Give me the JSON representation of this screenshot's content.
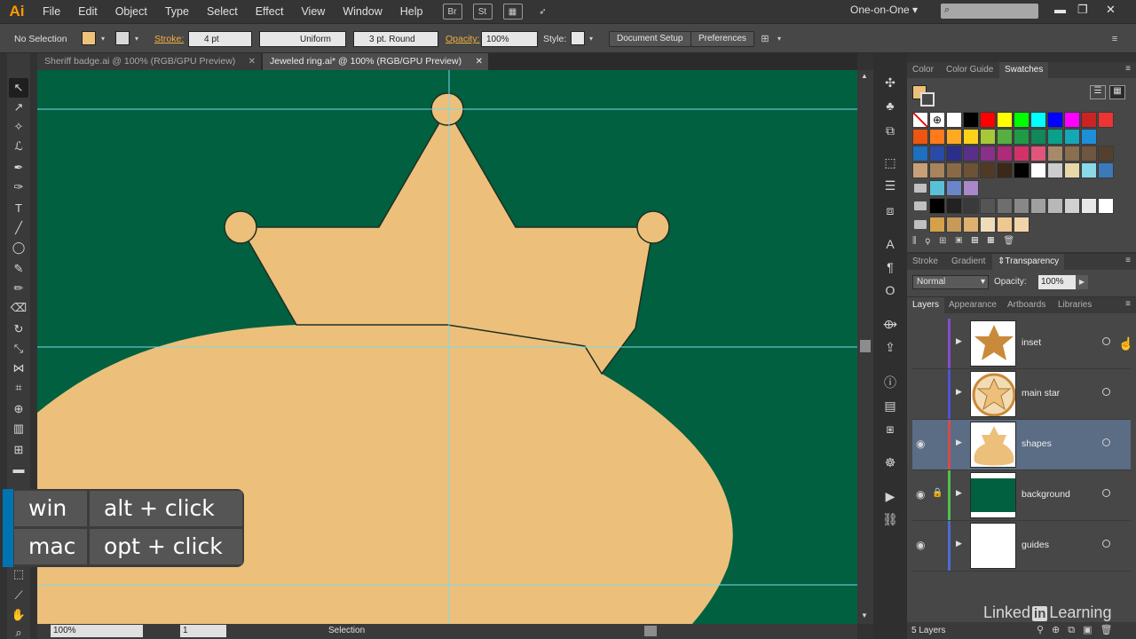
{
  "app": {
    "logo": "Ai"
  },
  "menu": [
    "File",
    "Edit",
    "Object",
    "Type",
    "Select",
    "Effect",
    "View",
    "Window",
    "Help"
  ],
  "menu_icons": {
    "bridge": "Br",
    "stock": "St"
  },
  "workspace": "One-on-One",
  "search_icon": "⌕",
  "control_bar": {
    "selection": "No Selection",
    "fill_color": "#eec27b",
    "stroke_label": "Stroke:",
    "stroke_weight": "4 pt",
    "stroke_profile": "Uniform",
    "brush": "3 pt. Round",
    "opacity_label": "Opacity:",
    "opacity_value": "100%",
    "style_label": "Style:",
    "document_setup": "Document Setup",
    "preferences": "Preferences"
  },
  "tabs": [
    {
      "label": "Sheriff badge.ai @ 100% (RGB/GPU Preview)",
      "active": false
    },
    {
      "label": "Jeweled ring.ai* @ 100% (RGB/GPU Preview)",
      "active": true
    }
  ],
  "status": {
    "zoom": "100%",
    "page": "1",
    "tool": "Selection"
  },
  "shortcut": {
    "win_key": "win",
    "win_action": "alt + click",
    "mac_key": "mac",
    "mac_action": "opt + click"
  },
  "colors": {
    "canvas_bg": "#006040",
    "shape_fill": "#ecc07a",
    "guide": "#7fd9e6",
    "selection_row": "#5b6c85"
  },
  "swatches_panel": {
    "tabs": [
      "Color",
      "Color Guide",
      "Swatches"
    ],
    "active_tab": "Swatches"
  },
  "transparency_panel": {
    "tabs": [
      "Stroke",
      "Gradient",
      "Transparency"
    ],
    "active_tab": "Transparency",
    "blend_mode": "Normal",
    "opacity_label": "Opacity:",
    "opacity_value": "100%"
  },
  "layers_panel": {
    "tabs": [
      "Layers",
      "Appearance",
      "Artboards",
      "Libraries"
    ],
    "active_tab": "Layers",
    "layers": [
      {
        "name": "inset",
        "color": "#8a4bd0",
        "visible": false,
        "locked": false,
        "selected": false
      },
      {
        "name": "main star",
        "color": "#4f53d6",
        "visible": false,
        "locked": false,
        "selected": false
      },
      {
        "name": "shapes",
        "color": "#d04e4e",
        "visible": true,
        "locked": false,
        "selected": true
      },
      {
        "name": "background",
        "color": "#4ec24e",
        "visible": true,
        "locked": true,
        "selected": false
      },
      {
        "name": "guides",
        "color": "#4f6ad6",
        "visible": true,
        "locked": false,
        "selected": false
      }
    ],
    "count": "5 Layers"
  },
  "watermark": {
    "prefix": "Linked",
    "in": "in",
    "suffix": "Learning"
  }
}
